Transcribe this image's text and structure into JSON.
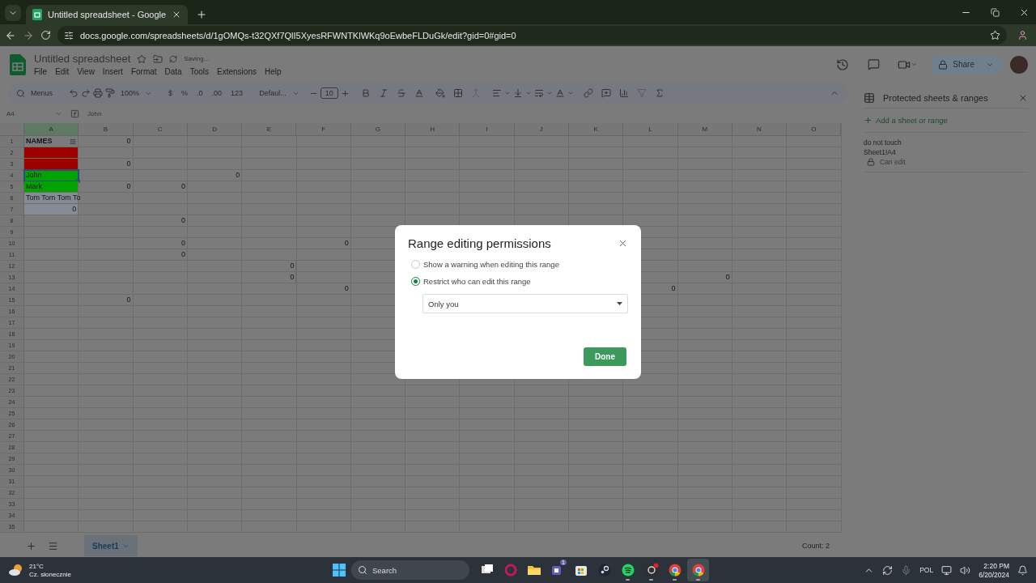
{
  "browser": {
    "tab_title": "Untitled spreadsheet - Google",
    "url": "docs.google.com/spreadsheets/d/1gOMQs-t32QXf7QlI5XyesRFWNTKlWKq9oEwbeFLDuGk/edit?gid=0#gid=0"
  },
  "doc": {
    "title": "Untitled spreadsheet",
    "status": "Saving...",
    "menu": [
      "File",
      "Edit",
      "View",
      "Insert",
      "Format",
      "Data",
      "Tools",
      "Extensions",
      "Help"
    ],
    "share": "Share"
  },
  "toolbar": {
    "search": "Menus",
    "zoom": "100%",
    "currency": "$",
    "percent": "%",
    "decrease_decimals": ".0",
    "increase_decimals": ".00",
    "number_format": "123",
    "font": "Defaul...",
    "font_size": "10"
  },
  "formula_bar": {
    "cell": "A4",
    "value": "John"
  },
  "sheet": {
    "columns": [
      {
        "label": "A",
        "selected": true
      },
      {
        "label": "B",
        "selected": false
      },
      {
        "label": "C",
        "selected": false
      },
      {
        "label": "D",
        "selected": false
      },
      {
        "label": "E",
        "selected": false
      },
      {
        "label": "F",
        "selected": false
      },
      {
        "label": "G",
        "selected": false
      },
      {
        "label": "H",
        "selected": false
      },
      {
        "label": "I",
        "selected": false
      },
      {
        "label": "J",
        "selected": false
      },
      {
        "label": "K",
        "selected": false
      },
      {
        "label": "L",
        "selected": false
      },
      {
        "label": "M",
        "selected": false
      },
      {
        "label": "N",
        "selected": false
      },
      {
        "label": "O",
        "selected": false
      }
    ],
    "rows": [
      {
        "number": "1",
        "cells": {
          "a": {
            "kind": "header",
            "value": "NAMES"
          },
          "b": {
            "kind": "number",
            "value": "0"
          }
        }
      },
      {
        "number": "2",
        "cells": {
          "a": {
            "kind": "fill",
            "color": "#9e0000"
          }
        }
      },
      {
        "number": "3",
        "cells": {
          "a": {
            "kind": "fill",
            "color": "#9e0000"
          },
          "b": {
            "kind": "number",
            "value": "0"
          }
        }
      },
      {
        "number": "4",
        "cells": {
          "a": {
            "kind": "text",
            "value": "John",
            "color": "#00a300",
            "selected": true
          },
          "d": {
            "kind": "number",
            "value": "0"
          }
        }
      },
      {
        "number": "5",
        "cells": {
          "a": {
            "kind": "text",
            "value": "Mark",
            "color": "#00a300",
            "selected": false
          },
          "b": {
            "kind": "number",
            "value": "0"
          },
          "c": {
            "kind": "number",
            "value": "0"
          }
        }
      },
      {
        "number": "6",
        "cells": {
          "a": {
            "kind": "text",
            "value": "Tom Tom Tom To",
            "color": "#868b96"
          }
        }
      },
      {
        "number": "7",
        "cells": {
          "a": {
            "kind": "number",
            "value": "0",
            "color": "#868b96"
          }
        }
      },
      {
        "number": "8",
        "cells": {
          "c": {
            "kind": "number",
            "value": "0"
          }
        }
      },
      {
        "number": "9",
        "cells": {}
      },
      {
        "number": "10",
        "cells": {
          "c": {
            "kind": "number",
            "value": "0"
          },
          "f": {
            "kind": "number",
            "value": "0"
          }
        }
      },
      {
        "number": "11",
        "cells": {
          "c": {
            "kind": "number",
            "value": "0"
          }
        }
      },
      {
        "number": "12",
        "cells": {
          "e": {
            "kind": "number",
            "value": "0"
          }
        }
      },
      {
        "number": "13",
        "cells": {
          "e": {
            "kind": "number",
            "value": "0"
          },
          "m": {
            "kind": "number",
            "value": "0"
          }
        }
      },
      {
        "number": "14",
        "cells": {
          "f": {
            "kind": "number",
            "value": "0"
          },
          "l": {
            "kind": "number",
            "value": "0"
          }
        }
      },
      {
        "number": "15",
        "cells": {
          "b": {
            "kind": "number",
            "value": "0"
          }
        }
      },
      {
        "number": "16",
        "cells": {}
      },
      {
        "number": "17",
        "cells": {}
      },
      {
        "number": "18",
        "cells": {}
      },
      {
        "number": "19",
        "cells": {}
      },
      {
        "number": "20",
        "cells": {}
      },
      {
        "number": "21",
        "cells": {}
      },
      {
        "number": "22",
        "cells": {}
      },
      {
        "number": "23",
        "cells": {}
      },
      {
        "number": "24",
        "cells": {}
      },
      {
        "number": "25",
        "cells": {}
      },
      {
        "number": "26",
        "cells": {}
      },
      {
        "number": "27",
        "cells": {}
      },
      {
        "number": "28",
        "cells": {}
      },
      {
        "number": "29",
        "cells": {}
      },
      {
        "number": "30",
        "cells": {}
      },
      {
        "number": "31",
        "cells": {}
      },
      {
        "number": "32",
        "cells": {}
      },
      {
        "number": "33",
        "cells": {}
      },
      {
        "number": "34",
        "cells": {}
      },
      {
        "number": "35",
        "cells": {}
      }
    ]
  },
  "sheet_tabs": [
    {
      "label": "Sheet1",
      "selected": true
    }
  ],
  "status": "Count: 2",
  "panel": {
    "title": "Protected sheets & ranges",
    "add": "Add a sheet or range",
    "ranges": [
      {
        "description": "do not touch",
        "range": "Sheet1!A4",
        "access": "Can edit"
      }
    ]
  },
  "dialog": {
    "title": "Range editing permissions",
    "options": [
      {
        "label": "Show a warning when editing this range",
        "selected": false
      },
      {
        "label": "Restrict who can edit this range",
        "selected": true
      }
    ],
    "dropdown": "Only you",
    "button": "Done"
  },
  "taskbar": {
    "temperature": "21°C",
    "weather": "Cz. słonecznie",
    "search": "Search",
    "apps": [
      {
        "kind": "taskview",
        "running": false,
        "selected": false
      },
      {
        "kind": "ring",
        "running": false,
        "selected": false
      },
      {
        "kind": "folder",
        "running": false,
        "selected": false
      },
      {
        "kind": "teams",
        "badge": "1",
        "running": false,
        "selected": false
      },
      {
        "kind": "store",
        "running": false,
        "selected": false
      },
      {
        "kind": "steam",
        "running": false,
        "selected": false
      },
      {
        "kind": "spotify",
        "running": true,
        "selected": false
      },
      {
        "kind": "obs",
        "running": true,
        "selected": false
      },
      {
        "kind": "chrome",
        "running": true,
        "selected": false
      },
      {
        "kind": "chrome",
        "running": true,
        "selected": true
      }
    ],
    "language": "POL",
    "time": "2:20 PM",
    "date": "6/20/2024"
  }
}
